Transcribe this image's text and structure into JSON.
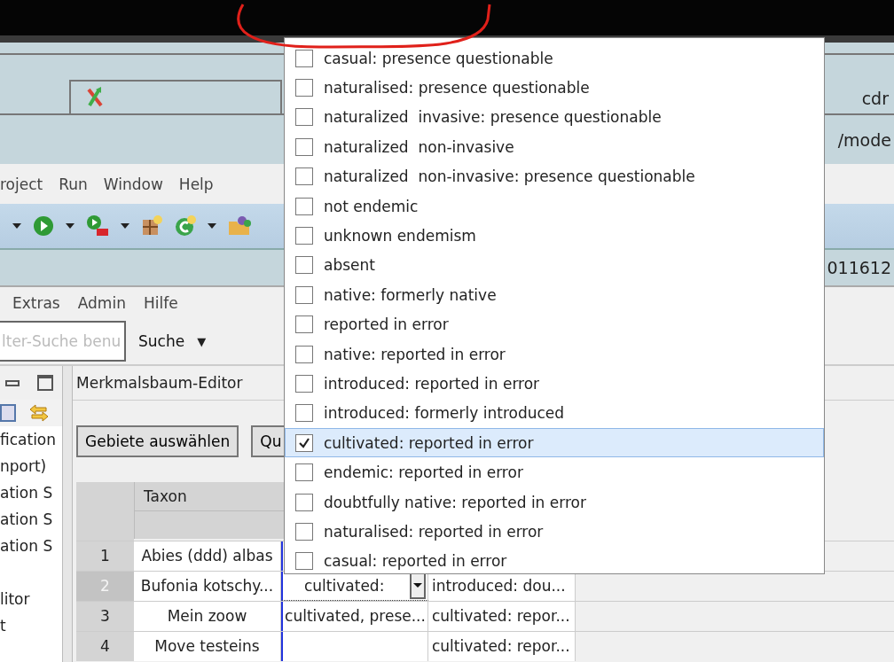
{
  "header": {
    "tab_text": "cdr",
    "path_text": "/mode",
    "id_text": "011612"
  },
  "menu_bar": {
    "items": [
      "roject",
      "Run",
      "Window",
      "Help"
    ]
  },
  "menu_bar_2": {
    "items": [
      "Extras",
      "Admin",
      "Hilfe"
    ]
  },
  "search": {
    "placeholder": "lter-Suche benu",
    "button": "Suche",
    "caret": "▼"
  },
  "left_panel": {
    "groups": [
      [
        "fication",
        "nport)",
        "ation S",
        "ation S",
        "ation S"
      ],
      [
        "litor",
        "t"
      ]
    ]
  },
  "editor": {
    "title": "Merkmalsbaum-Editor",
    "buttons": [
      "Gebiete auswählen",
      "Qu"
    ],
    "table": {
      "columns": [
        "Taxon"
      ],
      "rows": [
        {
          "number": "1",
          "taxon": "Abies (ddd) albas",
          "selected": false
        },
        {
          "number": "2",
          "taxon": "Bufonia kotschy...",
          "column_3": {
            "kind": "combo",
            "text": "cultivated:"
          },
          "column_4": "introduced: dou...",
          "selected": true
        },
        {
          "number": "3",
          "taxon": "Mein zoow",
          "column_3": {
            "kind": "text",
            "text": "cultivated, prese..."
          },
          "column_4": "cultivated: repor...",
          "selected": false
        },
        {
          "number": "4",
          "taxon": "Move testeins",
          "column_4": "cultivated: repor...",
          "selected": false
        }
      ]
    }
  },
  "popup": {
    "items": [
      {
        "label": "casual: presence questionable",
        "checked": false,
        "selected": false
      },
      {
        "label": "naturalised: presence questionable",
        "checked": false,
        "selected": false
      },
      {
        "label": "naturalized  invasive: presence questionable",
        "checked": false,
        "selected": false
      },
      {
        "label": "naturalized  non-invasive",
        "checked": false,
        "selected": false
      },
      {
        "label": "naturalized  non-invasive: presence questionable",
        "checked": false,
        "selected": false
      },
      {
        "label": "not endemic",
        "checked": false,
        "selected": false
      },
      {
        "label": "unknown endemism",
        "checked": false,
        "selected": false
      },
      {
        "label": "absent",
        "checked": false,
        "selected": false
      },
      {
        "label": "native: formerly native",
        "checked": false,
        "selected": false
      },
      {
        "label": "reported in error",
        "checked": false,
        "selected": false
      },
      {
        "label": "native: reported in error",
        "checked": false,
        "selected": false
      },
      {
        "label": "introduced: reported in error",
        "checked": false,
        "selected": false
      },
      {
        "label": "introduced: formerly introduced",
        "checked": false,
        "selected": false
      },
      {
        "label": "cultivated: reported in error",
        "checked": true,
        "selected": true
      },
      {
        "label": "endemic: reported in error",
        "checked": false,
        "selected": false
      },
      {
        "label": "doubtfully native: reported in error",
        "checked": false,
        "selected": false
      },
      {
        "label": "naturalised: reported in error",
        "checked": false,
        "selected": false
      },
      {
        "label": "casual: reported in error",
        "checked": false,
        "selected": false
      }
    ]
  }
}
